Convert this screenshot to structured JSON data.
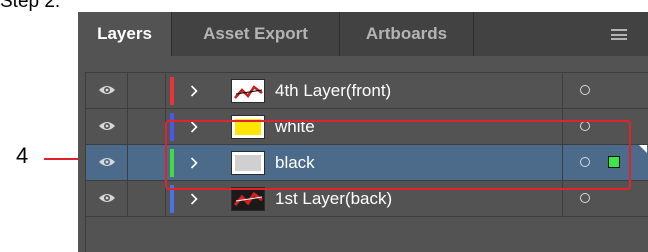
{
  "caption": "Step 2:",
  "callout_number": "4",
  "tabs": [
    {
      "label": "Layers",
      "active": true
    },
    {
      "label": "Asset Export",
      "active": false
    },
    {
      "label": "Artboards",
      "active": false
    }
  ],
  "panel_menu_icon": "hamburger-menu-icon",
  "layers": [
    {
      "name": "4th Layer(front)",
      "color": "#e8353b",
      "thumbnail": "red-white-art",
      "selected": false,
      "selection_indicator": false
    },
    {
      "name": "white",
      "color": "#4a57e8",
      "thumbnail": "yellow-fill",
      "selected": false,
      "selection_indicator": false
    },
    {
      "name": "black",
      "color": "#3ddc40",
      "thumbnail": "light-gray-fill",
      "selected": true,
      "selection_indicator": true
    },
    {
      "name": "1st Layer(back)",
      "color": "#4a72e8",
      "thumbnail": "red-black-art",
      "selected": false,
      "selection_indicator": false
    }
  ],
  "colors": {
    "panel_bg": "#535353",
    "tab_bar_bg": "#424242",
    "selected_row": "#4c6b8b",
    "highlight_box": "#e3232b",
    "selection_square": "#38e84a"
  }
}
